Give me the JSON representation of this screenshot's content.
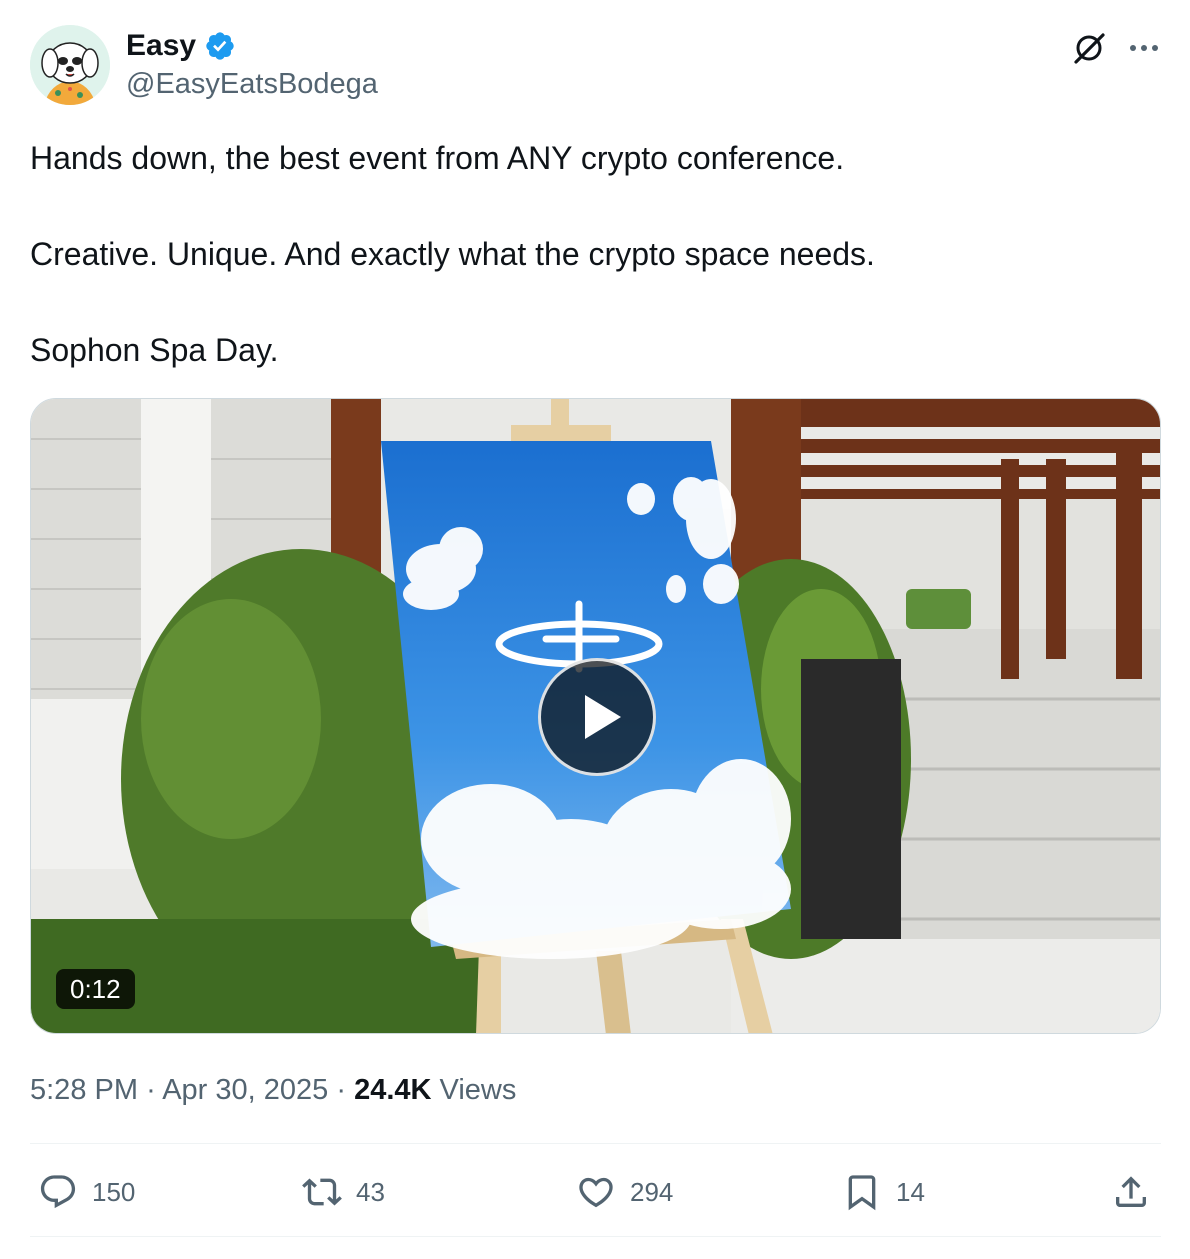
{
  "author": {
    "name": "Easy",
    "handle": "@EasyEatsBodega",
    "verified": true,
    "avatar_icon": "cartoon-dog-avatar"
  },
  "header_icons": [
    "grok-icon",
    "more-icon"
  ],
  "tweet": {
    "lines": [
      "Hands down, the best event from ANY crypto conference.",
      "Creative. Unique. And exactly what the crypto space needs.",
      "Sophon Spa Day."
    ]
  },
  "video": {
    "duration": "0:12",
    "play_icon": "play-icon"
  },
  "meta": {
    "time": "5:28 PM",
    "separator": "·",
    "date": "Apr 30, 2025",
    "views_count": "24.4K",
    "views_label": "Views"
  },
  "actions": {
    "replies": "150",
    "reposts": "43",
    "likes": "294",
    "bookmarks": "14"
  },
  "colors": {
    "text": "#0f1419",
    "secondary": "#536471",
    "verified_blue": "#1d9bf0",
    "divider": "#eff3f4"
  }
}
